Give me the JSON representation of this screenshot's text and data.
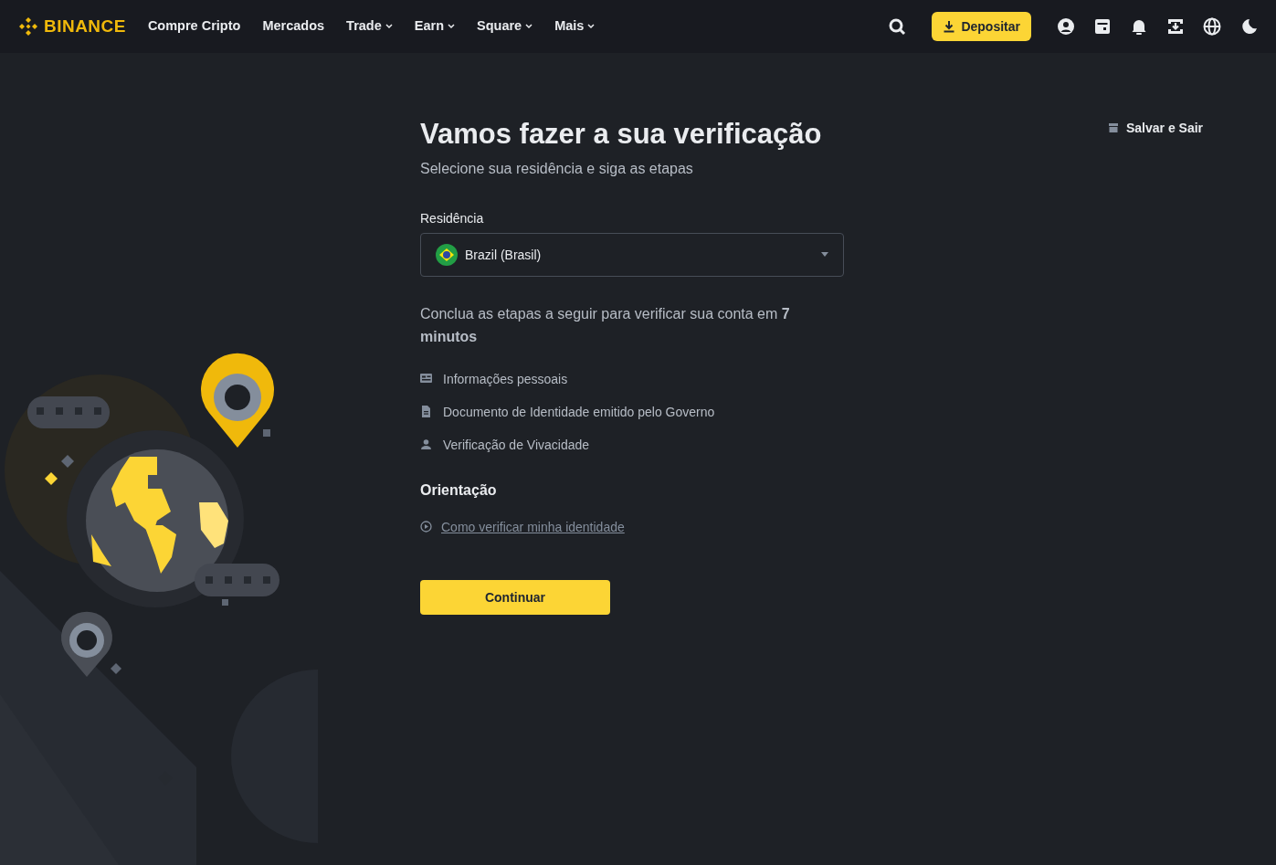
{
  "header": {
    "logo": "BINANCE",
    "nav": [
      {
        "label": "Compre Cripto",
        "dropdown": false
      },
      {
        "label": "Mercados",
        "dropdown": false
      },
      {
        "label": "Trade",
        "dropdown": true
      },
      {
        "label": "Earn",
        "dropdown": true
      },
      {
        "label": "Square",
        "dropdown": true
      },
      {
        "label": "Mais",
        "dropdown": true
      }
    ],
    "deposit_button": "Depositar"
  },
  "page": {
    "title": "Vamos fazer a sua verificação",
    "subtitle": "Selecione sua residência e siga as etapas",
    "save_exit": "Salvar e Sair",
    "residence": {
      "label": "Residência",
      "value": "Brazil (Brasil)"
    },
    "intro": "Conclua as etapas a seguir para verificar sua conta em **7 minutos**",
    "steps": [
      {
        "kind": "id-card",
        "label": "Informações pessoais"
      },
      {
        "kind": "document",
        "label": "Documento de Identidade emitido pelo Governo"
      },
      {
        "kind": "person",
        "label": "Verificação de Vivacidade"
      }
    ],
    "guidance": {
      "heading": "Orientação",
      "link": "Como verificar minha identidade"
    },
    "continue_button": "Continuar"
  }
}
